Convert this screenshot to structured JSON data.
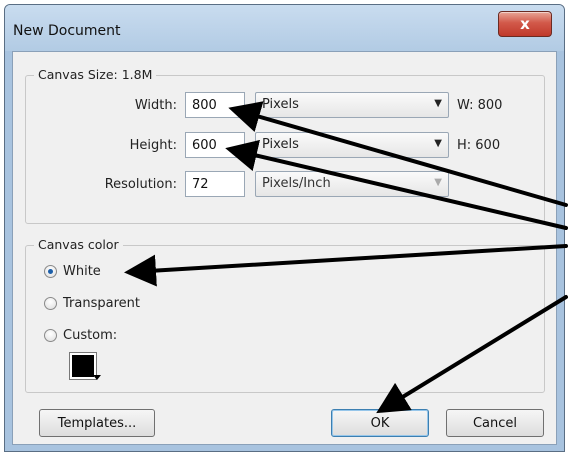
{
  "dialog": {
    "title": "New Document",
    "close_symbol": "x"
  },
  "canvas_size": {
    "label": "Canvas Size: 1.8M",
    "width": {
      "label": "Width:",
      "value": "800",
      "unit": "Pixels",
      "readout": "W: 800"
    },
    "height": {
      "label": "Height:",
      "value": "600",
      "unit": "Pixels",
      "readout": "H: 600"
    },
    "resolution": {
      "label": "Resolution:",
      "value": "72",
      "unit": "Pixels/Inch"
    }
  },
  "canvas_color": {
    "label": "Canvas color",
    "options": [
      {
        "label": "White",
        "checked": true
      },
      {
        "label": "Transparent",
        "checked": false
      },
      {
        "label": "Custom:",
        "checked": false
      }
    ],
    "swatch_color": "#000000"
  },
  "buttons": {
    "templates": "Templates...",
    "ok": "OK",
    "cancel": "Cancel"
  },
  "icons": {
    "close": "close-icon",
    "dropdown": "chevron-down-icon",
    "swatch_menu": "triangle-down-icon"
  },
  "colors": {
    "title_bar": "#b2cbe4",
    "close_button": "#c0392b",
    "dialog_body": "#f0f0f0",
    "annotation_arrow": "#000000"
  }
}
